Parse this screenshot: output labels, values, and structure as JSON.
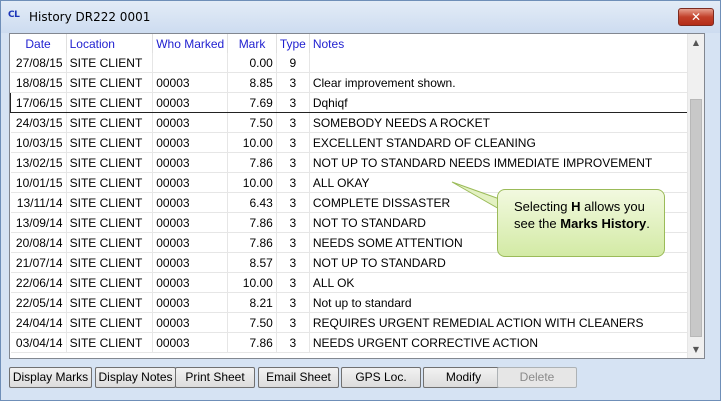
{
  "window": {
    "title": "History DR222 0001",
    "icon_text": "CL",
    "close_label": "✕"
  },
  "table": {
    "columns": [
      "Date",
      "Location",
      "Who Marked",
      "Mark",
      "Type",
      "Notes"
    ],
    "rows": [
      {
        "date": "27/08/15",
        "location": "SITE CLIENT",
        "who": "",
        "mark": "0.00",
        "type": "9",
        "notes": ""
      },
      {
        "date": "18/08/15",
        "location": "SITE CLIENT",
        "who": "00003",
        "mark": "8.85",
        "type": "3",
        "notes": "Clear improvement shown."
      },
      {
        "date": "17/06/15",
        "location": "SITE CLIENT",
        "who": "00003",
        "mark": "7.69",
        "type": "3",
        "notes": "Dqhiqf"
      },
      {
        "date": "24/03/15",
        "location": "SITE CLIENT",
        "who": "00003",
        "mark": "7.50",
        "type": "3",
        "notes": "SOMEBODY NEEDS A ROCKET"
      },
      {
        "date": "10/03/15",
        "location": "SITE CLIENT",
        "who": "00003",
        "mark": "10.00",
        "type": "3",
        "notes": "EXCELLENT STANDARD OF CLEANING"
      },
      {
        "date": "13/02/15",
        "location": "SITE CLIENT",
        "who": "00003",
        "mark": "7.86",
        "type": "3",
        "notes": "NOT UP TO STANDARD NEEDS IMMEDIATE IMPROVEMENT"
      },
      {
        "date": "10/01/15",
        "location": "SITE CLIENT",
        "who": "00003",
        "mark": "10.00",
        "type": "3",
        "notes": "ALL OKAY"
      },
      {
        "date": "13/11/14",
        "location": "SITE CLIENT",
        "who": "00003",
        "mark": "6.43",
        "type": "3",
        "notes": "COMPLETE DISSASTER"
      },
      {
        "date": "13/09/14",
        "location": "SITE CLIENT",
        "who": "00003",
        "mark": "7.86",
        "type": "3",
        "notes": "NOT TO STANDARD"
      },
      {
        "date": "20/08/14",
        "location": "SITE CLIENT",
        "who": "00003",
        "mark": "7.86",
        "type": "3",
        "notes": "NEEDS SOME ATTENTION"
      },
      {
        "date": "21/07/14",
        "location": "SITE CLIENT",
        "who": "00003",
        "mark": "8.57",
        "type": "3",
        "notes": "NOT UP TO STANDARD"
      },
      {
        "date": "22/06/14",
        "location": "SITE CLIENT",
        "who": "00003",
        "mark": "10.00",
        "type": "3",
        "notes": "ALL OK"
      },
      {
        "date": "22/05/14",
        "location": "SITE CLIENT",
        "who": "00003",
        "mark": "8.21",
        "type": "3",
        "notes": "Not up to standard"
      },
      {
        "date": "24/04/14",
        "location": "SITE CLIENT",
        "who": "00003",
        "mark": "7.50",
        "type": "3",
        "notes": "REQUIRES URGENT REMEDIAL ACTION WITH CLEANERS"
      },
      {
        "date": "03/04/14",
        "location": "SITE CLIENT",
        "who": "00003",
        "mark": "7.86",
        "type": "3",
        "notes": "NEEDS URGENT CORRECTIVE ACTION"
      }
    ],
    "focused_row": 2
  },
  "callout": {
    "prefix": "Selecting ",
    "key": "H",
    "middle": " allows you see the ",
    "target": "Marks History",
    "suffix": "."
  },
  "buttons": [
    {
      "label": "Display Marks",
      "enabled": true
    },
    {
      "label": "Display Notes",
      "enabled": true
    },
    {
      "label": "Print Sheet",
      "enabled": true
    },
    {
      "label": "Email Sheet",
      "enabled": true
    },
    {
      "label": "GPS Loc.",
      "enabled": true
    },
    {
      "label": "Modify",
      "enabled": true
    },
    {
      "label": "Delete",
      "enabled": false
    }
  ],
  "icons": {
    "scroll_up": "scroll-up-icon",
    "scroll_down": "scroll-down-icon",
    "close": "close-icon"
  }
}
